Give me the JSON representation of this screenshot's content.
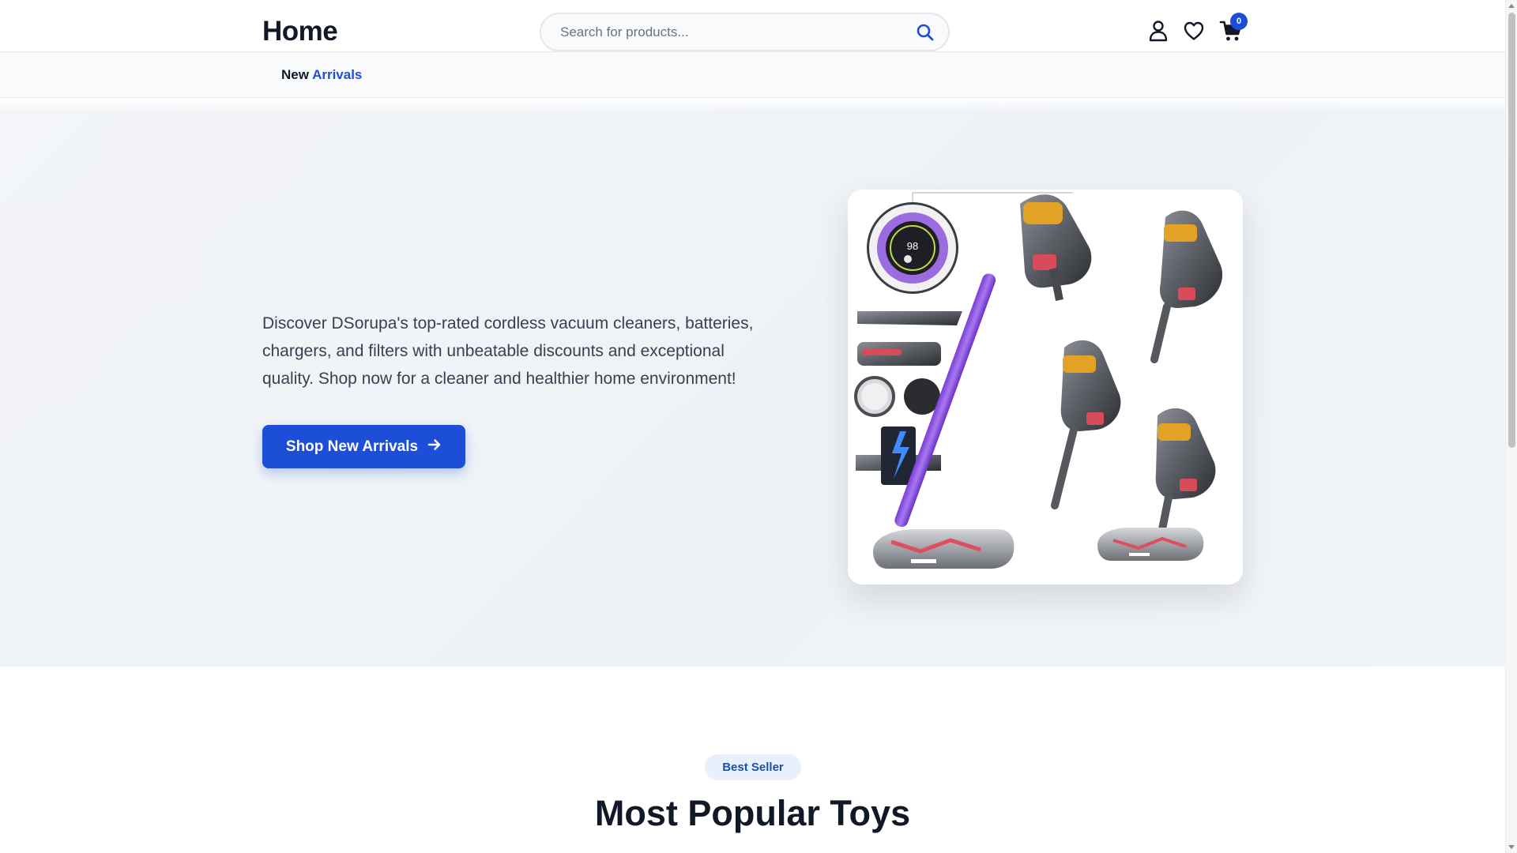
{
  "header": {
    "logo": "Home",
    "search_placeholder": "Search for products...",
    "cart_count": "0",
    "icons": [
      "search-icon",
      "user-icon",
      "heart-icon",
      "cart-icon"
    ]
  },
  "nav": {
    "item_word1": "New",
    "item_word2": "Arrivals"
  },
  "hero": {
    "description": "Discover DSorupa's top-rated cordless vacuum cleaners, batteries, chargers, and filters with unbeatable discounts and exceptional quality. Shop now for a cleaner and healthier home environment!",
    "cta_label": "Shop New Arrivals",
    "cta_icon": "arrow-right-icon",
    "image_display": "98"
  },
  "section": {
    "badge": "Best Seller",
    "title": "Most Popular Toys"
  },
  "colors": {
    "accent": "#1d4ed8",
    "text_dark": "#111827",
    "text_body": "#374151",
    "hero_bg": "#f1f4f8",
    "badge_bg": "#e8f0fb"
  }
}
